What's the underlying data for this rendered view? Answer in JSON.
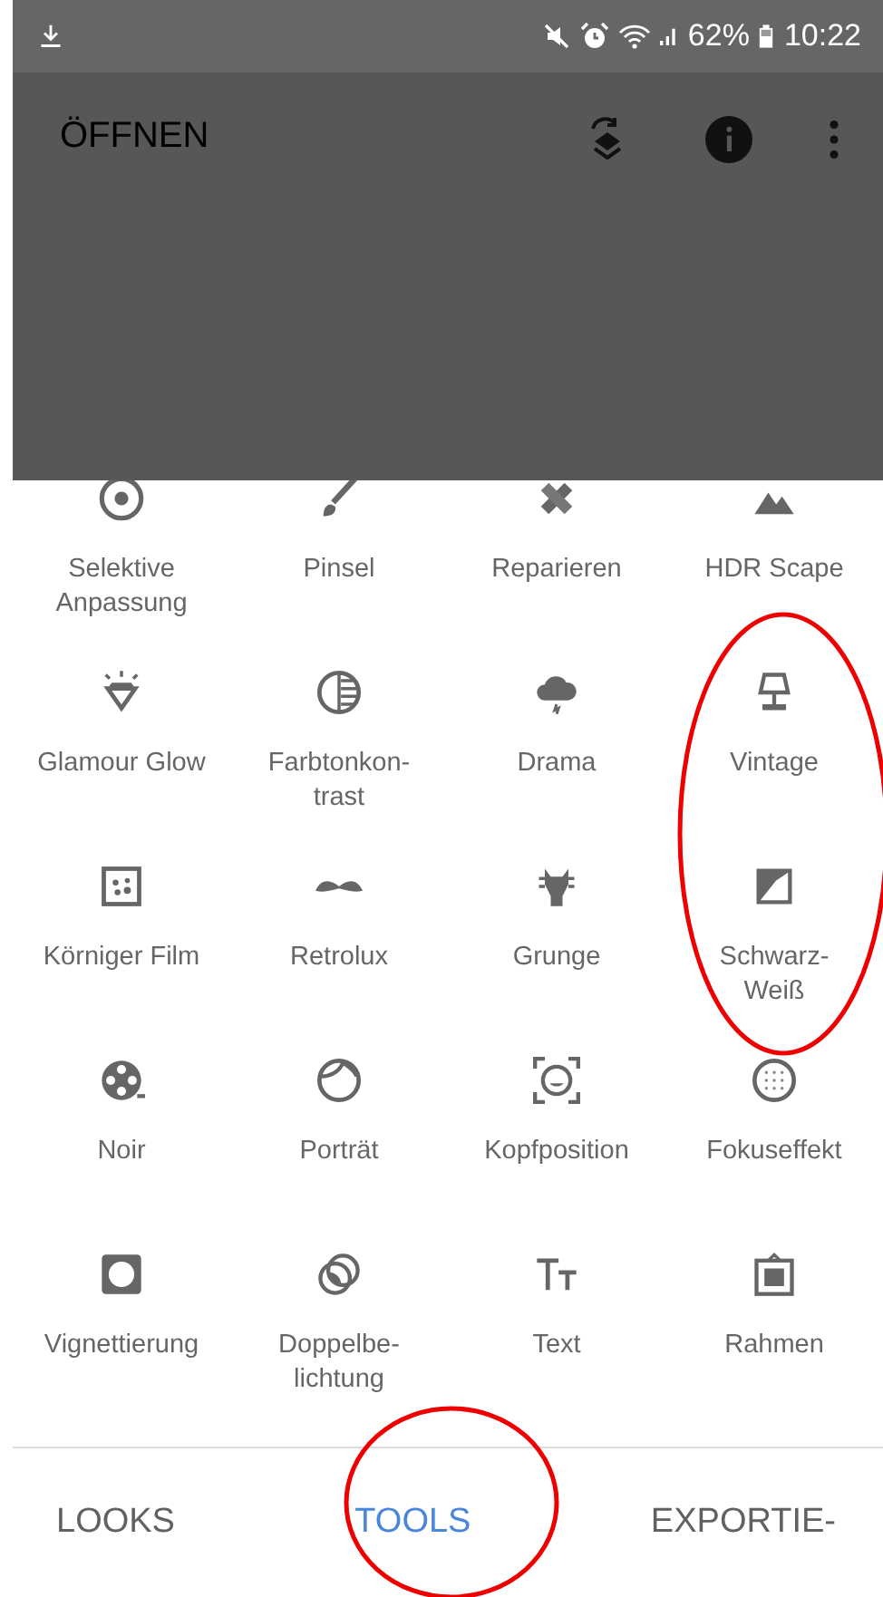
{
  "status_bar": {
    "battery": "62%",
    "time": "10:22"
  },
  "app_bar": {
    "title": "ÖFFNEN"
  },
  "tools": [
    {
      "label": "Selektive Anpassung"
    },
    {
      "label": "Pinsel"
    },
    {
      "label": "Reparieren"
    },
    {
      "label": "HDR Scape"
    },
    {
      "label": "Glamour Glow"
    },
    {
      "label": "Farbtonkon-\ntrast"
    },
    {
      "label": "Drama"
    },
    {
      "label": "Vintage"
    },
    {
      "label": "Körniger Film"
    },
    {
      "label": "Retrolux"
    },
    {
      "label": "Grunge"
    },
    {
      "label": "Schwarz-\nWeiß"
    },
    {
      "label": "Noir"
    },
    {
      "label": "Porträt"
    },
    {
      "label": "Kopfposition"
    },
    {
      "label": "Fokuseffekt"
    },
    {
      "label": "Vignettierung"
    },
    {
      "label": "Doppelbe-\nlichtung"
    },
    {
      "label": "Text"
    },
    {
      "label": "Rahmen"
    }
  ],
  "tabs": [
    {
      "label": "LOOKS",
      "selected": false
    },
    {
      "label": "TOOLS",
      "selected": true
    },
    {
      "label": "EXPORTIE-",
      "selected": false
    }
  ]
}
